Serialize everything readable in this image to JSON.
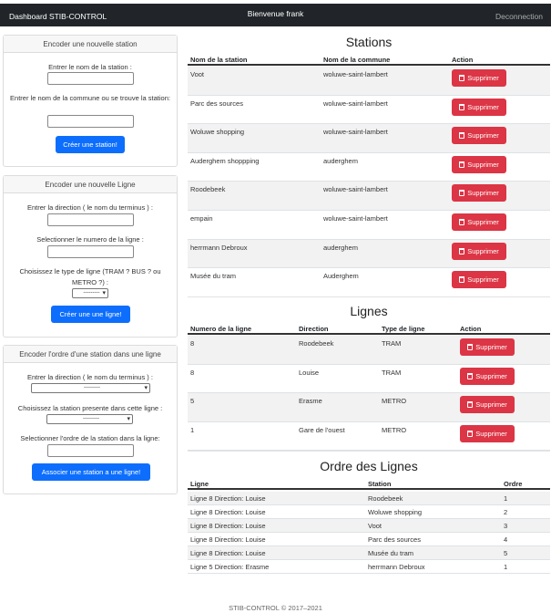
{
  "navbar": {
    "brand": "Dashboard STIB-CONTROL",
    "welcome": "Bienvenue frank",
    "logout": "Deconnection"
  },
  "forms": {
    "station": {
      "title": "Encoder une nouvelle station",
      "name_label": "Entrer le nom de la station :",
      "commune_label": "Entrer le nom de la commune ou se trouve la station:",
      "submit": "Créer une station!"
    },
    "line": {
      "title": "Encoder une nouvelle Ligne",
      "direction_label": "Entrer la direction ( le nom du terminus ) :",
      "number_label": "Selectionner le numero de la ligne :",
      "type_label": "Choisissez le type de ligne (TRAM ? BUS ? ou METRO ?) :",
      "type_select": "---------",
      "submit": "Créer une une ligne!"
    },
    "order": {
      "title": "Encoder l'ordre d'une station dans une ligne",
      "direction_label": "Entrer la direction ( le nom du terminus ) :",
      "direction_select": "---------",
      "station_label": "Choisissez la station presente dans cette ligne :",
      "station_select": "---------",
      "order_label": "Selectionner l'ordre de la station dans la ligne:",
      "submit": "Associer une station a une ligne!"
    }
  },
  "stations": {
    "title": "Stations",
    "headers": [
      "Nom de la station",
      "Nom de la commune",
      "Action"
    ],
    "delete_label": "Supprimer",
    "rows": [
      {
        "name": "Voot",
        "commune": "woluwe-saint-lambert"
      },
      {
        "name": "Parc des sources",
        "commune": "woluwe-saint-lambert"
      },
      {
        "name": "Woluwe shopping",
        "commune": "woluwe-saint-lambert"
      },
      {
        "name": "Auderghem shoppping",
        "commune": "auderghem"
      },
      {
        "name": "Roodebeek",
        "commune": "woluwe-saint-lambert"
      },
      {
        "name": "empain",
        "commune": "woluwe-saint-lambert"
      },
      {
        "name": "herrmann Debroux",
        "commune": "auderghem"
      },
      {
        "name": "Musée du tram",
        "commune": "Auderghem"
      }
    ]
  },
  "lines": {
    "title": "Lignes",
    "headers": [
      "Numero de la ligne",
      "Direction",
      "Type de ligne",
      "Action"
    ],
    "delete_label": "Supprimer",
    "rows": [
      {
        "number": "8",
        "direction": "Roodebeek",
        "type": "TRAM"
      },
      {
        "number": "8",
        "direction": "Louise",
        "type": "TRAM"
      },
      {
        "number": "5",
        "direction": "Erasme",
        "type": "METRO"
      },
      {
        "number": "1",
        "direction": "Gare de l'ouest",
        "type": "METRO"
      }
    ]
  },
  "order": {
    "title": "Ordre des Lignes",
    "headers": [
      "Ligne",
      "Station",
      "Ordre"
    ],
    "rows": [
      {
        "line": "Ligne 8 Direction: Louise",
        "station": "Roodebeek",
        "order": "1"
      },
      {
        "line": "Ligne 8 Direction: Louise",
        "station": "Woluwe shopping",
        "order": "2"
      },
      {
        "line": "Ligne 8 Direction: Louise",
        "station": "Voot",
        "order": "3"
      },
      {
        "line": "Ligne 8 Direction: Louise",
        "station": "Parc des sources",
        "order": "4"
      },
      {
        "line": "Ligne 8 Direction: Louise",
        "station": "Musée du tram",
        "order": "5"
      },
      {
        "line": "Ligne 5 Direction: Erasme",
        "station": "herrmann Debroux",
        "order": "1"
      }
    ]
  },
  "footer": "STIB-CONTROL © 2017–2021"
}
